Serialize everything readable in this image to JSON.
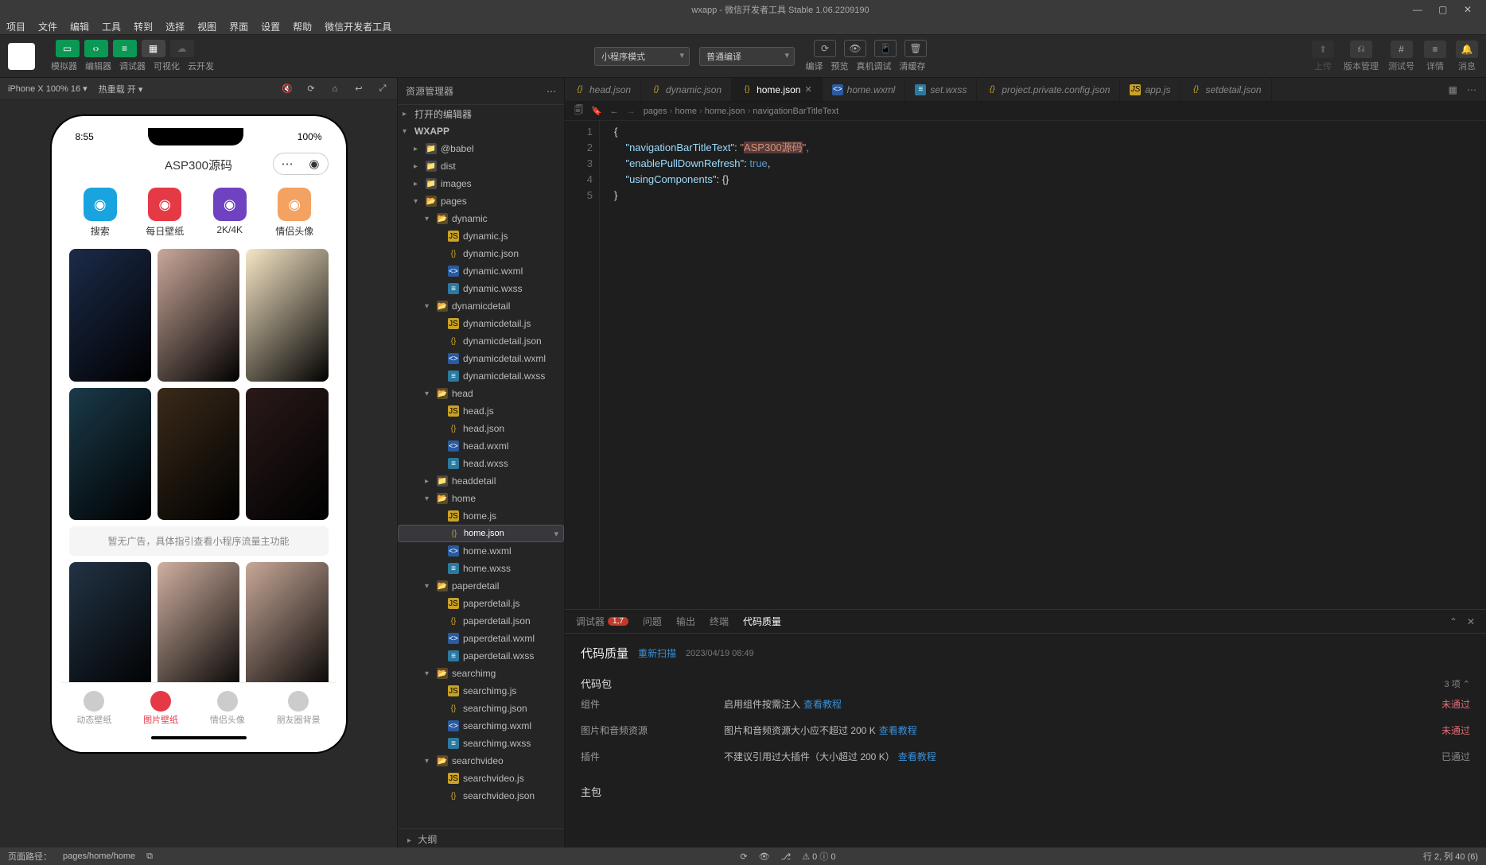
{
  "window": {
    "title": "wxapp - 微信开发者工具 Stable 1.06.2209190"
  },
  "menu": [
    "项目",
    "文件",
    "编辑",
    "工具",
    "转到",
    "选择",
    "视图",
    "界面",
    "设置",
    "帮助",
    "微信开发者工具"
  ],
  "toolbar": {
    "mode_labels": [
      "模拟器",
      "编辑器",
      "调试器",
      "可视化",
      "云开发"
    ],
    "compile_mode": "小程序模式",
    "compile_target": "普通编译",
    "action_labels": [
      "编译",
      "预览",
      "真机调试",
      "清缓存"
    ],
    "right_labels": [
      "上传",
      "版本管理",
      "测试号",
      "详情",
      "消息"
    ]
  },
  "simbar": {
    "device": "iPhone X 100% 16 ▾",
    "hot": "热重载 开 ▾"
  },
  "phone": {
    "time": "8:55",
    "battery": "100%",
    "title": "ASP300源码",
    "nav": [
      {
        "label": "搜索",
        "color": "#19a4e0"
      },
      {
        "label": "每日壁纸",
        "color": "#e63946"
      },
      {
        "label": "2K/4K",
        "color": "#6f42c1"
      },
      {
        "label": "情侣头像",
        "color": "#f4a261"
      }
    ],
    "ad": "暂无广告，具体指引查看小程序流量主功能",
    "tabs": [
      "动态壁纸",
      "图片壁纸",
      "情侣头像",
      "朋友圈背景"
    ],
    "active_tab": 1,
    "thumbcolors": [
      "#1c2b4a",
      "#caa89a",
      "#f7e7c6",
      "#1a3a4a",
      "#3a2a1a",
      "#2a1a1a",
      "#223344",
      "#d0b0a0",
      "#c8a898"
    ]
  },
  "explorer": {
    "title": "资源管理器",
    "open_editors": "打开的编辑器",
    "root": "WXAPP",
    "outline": "大纲",
    "tree": [
      {
        "d": 1,
        "t": "folderc",
        "n": "@babel"
      },
      {
        "d": 1,
        "t": "folderc",
        "n": "dist"
      },
      {
        "d": 1,
        "t": "folderc",
        "n": "images"
      },
      {
        "d": 1,
        "t": "folder",
        "n": "pages",
        "open": true
      },
      {
        "d": 2,
        "t": "folder",
        "n": "dynamic",
        "open": true
      },
      {
        "d": 3,
        "t": "js",
        "n": "dynamic.js"
      },
      {
        "d": 3,
        "t": "json",
        "n": "dynamic.json"
      },
      {
        "d": 3,
        "t": "wxml",
        "n": "dynamic.wxml"
      },
      {
        "d": 3,
        "t": "wxss",
        "n": "dynamic.wxss"
      },
      {
        "d": 2,
        "t": "folder",
        "n": "dynamicdetail",
        "open": true
      },
      {
        "d": 3,
        "t": "js",
        "n": "dynamicdetail.js"
      },
      {
        "d": 3,
        "t": "json",
        "n": "dynamicdetail.json"
      },
      {
        "d": 3,
        "t": "wxml",
        "n": "dynamicdetail.wxml"
      },
      {
        "d": 3,
        "t": "wxss",
        "n": "dynamicdetail.wxss"
      },
      {
        "d": 2,
        "t": "folder",
        "n": "head",
        "open": true
      },
      {
        "d": 3,
        "t": "js",
        "n": "head.js"
      },
      {
        "d": 3,
        "t": "json",
        "n": "head.json"
      },
      {
        "d": 3,
        "t": "wxml",
        "n": "head.wxml"
      },
      {
        "d": 3,
        "t": "wxss",
        "n": "head.wxss"
      },
      {
        "d": 2,
        "t": "folderc",
        "n": "headdetail"
      },
      {
        "d": 2,
        "t": "folder",
        "n": "home",
        "open": true
      },
      {
        "d": 3,
        "t": "js",
        "n": "home.js"
      },
      {
        "d": 3,
        "t": "json",
        "n": "home.json",
        "sel": true
      },
      {
        "d": 3,
        "t": "wxml",
        "n": "home.wxml"
      },
      {
        "d": 3,
        "t": "wxss",
        "n": "home.wxss"
      },
      {
        "d": 2,
        "t": "folder",
        "n": "paperdetail",
        "open": true
      },
      {
        "d": 3,
        "t": "js",
        "n": "paperdetail.js"
      },
      {
        "d": 3,
        "t": "json",
        "n": "paperdetail.json"
      },
      {
        "d": 3,
        "t": "wxml",
        "n": "paperdetail.wxml"
      },
      {
        "d": 3,
        "t": "wxss",
        "n": "paperdetail.wxss"
      },
      {
        "d": 2,
        "t": "folder",
        "n": "searchimg",
        "open": true
      },
      {
        "d": 3,
        "t": "js",
        "n": "searchimg.js"
      },
      {
        "d": 3,
        "t": "json",
        "n": "searchimg.json"
      },
      {
        "d": 3,
        "t": "wxml",
        "n": "searchimg.wxml"
      },
      {
        "d": 3,
        "t": "wxss",
        "n": "searchimg.wxss"
      },
      {
        "d": 2,
        "t": "folder",
        "n": "searchvideo",
        "open": true
      },
      {
        "d": 3,
        "t": "js",
        "n": "searchvideo.js"
      },
      {
        "d": 3,
        "t": "json",
        "n": "searchvideo.json"
      }
    ]
  },
  "tabs": [
    {
      "ico": "json",
      "n": "head.json"
    },
    {
      "ico": "json",
      "n": "dynamic.json"
    },
    {
      "ico": "json",
      "n": "home.json",
      "active": true,
      "close": true
    },
    {
      "ico": "wxml",
      "n": "home.wxml",
      "italic": true
    },
    {
      "ico": "wxss",
      "n": "set.wxss",
      "italic": true
    },
    {
      "ico": "json",
      "n": "project.private.config.json"
    },
    {
      "ico": "js",
      "n": "app.js"
    },
    {
      "ico": "json",
      "n": "setdetail.json"
    }
  ],
  "breadcrumb": [
    "pages",
    "home",
    "home.json",
    "navigationBarTitleText"
  ],
  "code": {
    "lines": [
      "1",
      "2",
      "3",
      "4",
      "5"
    ],
    "l1": "{",
    "l2_key": "\"navigationBarTitleText\"",
    "l2_sep": ": ",
    "l2_q": "\"",
    "l2_hl": "ASP300源码",
    "l2_end": "\",",
    "l3_key": "\"enablePullDownRefresh\"",
    "l3_sep": ": ",
    "l3_val": "true",
    "l3_end": ",",
    "l4_key": "\"usingComponents\"",
    "l4_sep": ": ",
    "l4_val": "{}",
    "l5": "}"
  },
  "panel": {
    "tabs": [
      "调试器",
      "问题",
      "输出",
      "终端",
      "代码质量"
    ],
    "badge": "1,7",
    "active": 4,
    "title": "代码质量",
    "rescan": "重新扫描",
    "timestamp": "2023/04/19 08:49",
    "section": "代码包",
    "count": "3 项 ⌃",
    "rows": [
      {
        "lab": "组件",
        "desc": "启用组件按需注入",
        "link": "查看教程",
        "stat": "未通过",
        "cls": "fail"
      },
      {
        "lab": "图片和音频资源",
        "desc": "图片和音频资源大小应不超过 200 K",
        "link": "查看教程",
        "stat": "未通过",
        "cls": "fail"
      },
      {
        "lab": "插件",
        "desc": "不建议引用过大插件（大小超过 200 K）",
        "link": "查看教程",
        "stat": "已通过",
        "cls": "pass"
      }
    ],
    "section2": "主包"
  },
  "status": {
    "path_label": "页面路径：",
    "path": "pages/home/home",
    "warn": "⚠ 0  ⓘ 0",
    "cursor": "行 2, 列 40 (6)"
  }
}
